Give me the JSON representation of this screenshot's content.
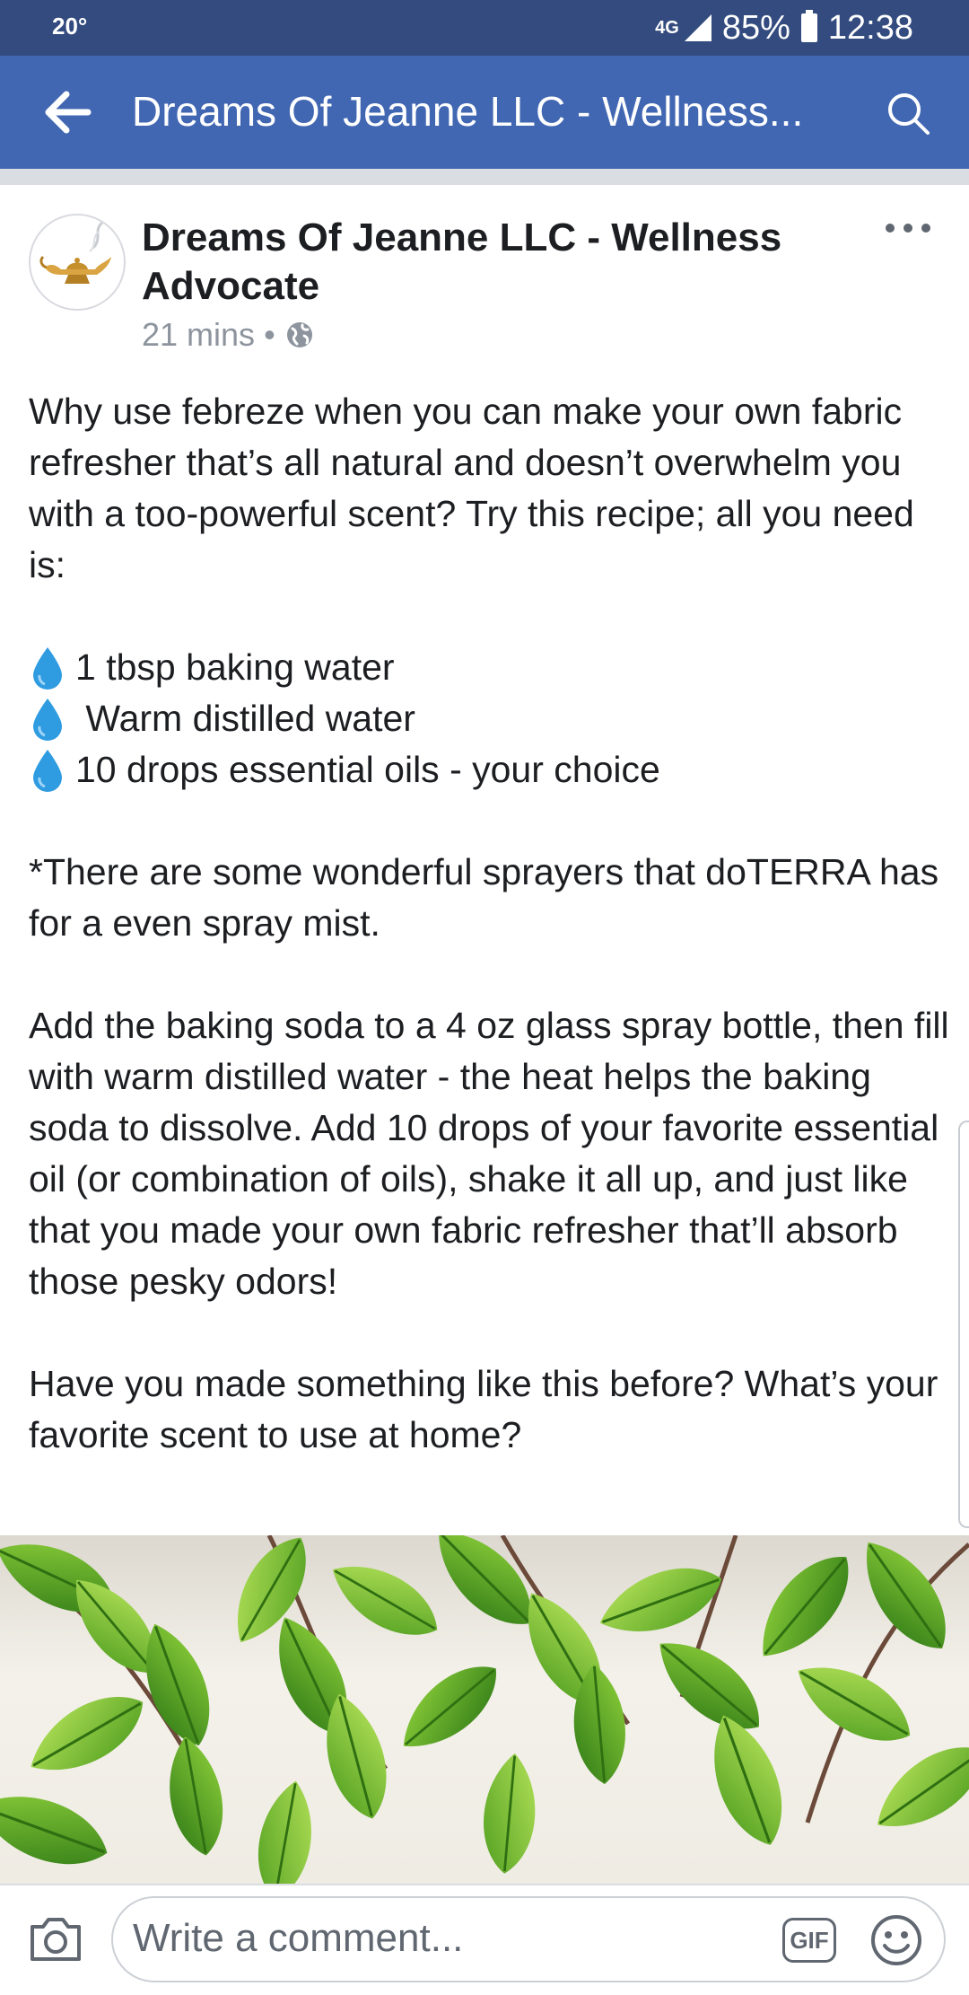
{
  "status_bar": {
    "temperature": "20°",
    "network": "4G",
    "battery": "85%",
    "time": "12:38"
  },
  "app_bar": {
    "title": "Dreams Of Jeanne LLC - Wellness...",
    "back_icon": "arrow-left-icon",
    "search_icon": "search-icon"
  },
  "post": {
    "author_line1": "Dreams Of Jeanne LLC - Wellness",
    "author_line2": "Advocate",
    "time_ago": "21 mins",
    "separator": "•",
    "privacy_icon": "globe-icon",
    "paragraph_intro": "Why use febreze when you can make your own fabric refresher that’s all natural and doesn’t overwhelm you with a too-powerful scent? Try this recipe; all you need is:",
    "ingredients": [
      "1 tbsp baking water",
      " Warm distilled water",
      "10 drops essential oils - your choice"
    ],
    "paragraph_note": "*There are some wonderful sprayers that doTERRA has for a even spray mist.",
    "paragraph_instructions": "Add the baking soda to a 4 oz glass spray bottle, then fill with warm distilled water - the heat helps the baking soda to dissolve. Add 10 drops of your favorite essential oil (or combination of oils), shake it all up, and just like that you made your own fabric refresher that’ll absorb those pesky odors!",
    "paragraph_question": "Have you made something like this before? What’s your favorite scent to use at home?"
  },
  "comment_bar": {
    "placeholder": "Write a comment...",
    "gif_label": "GIF"
  },
  "colors": {
    "status_bar": "#334b7e",
    "app_bar": "#4267b2",
    "water_drop": "#2f9be0"
  }
}
